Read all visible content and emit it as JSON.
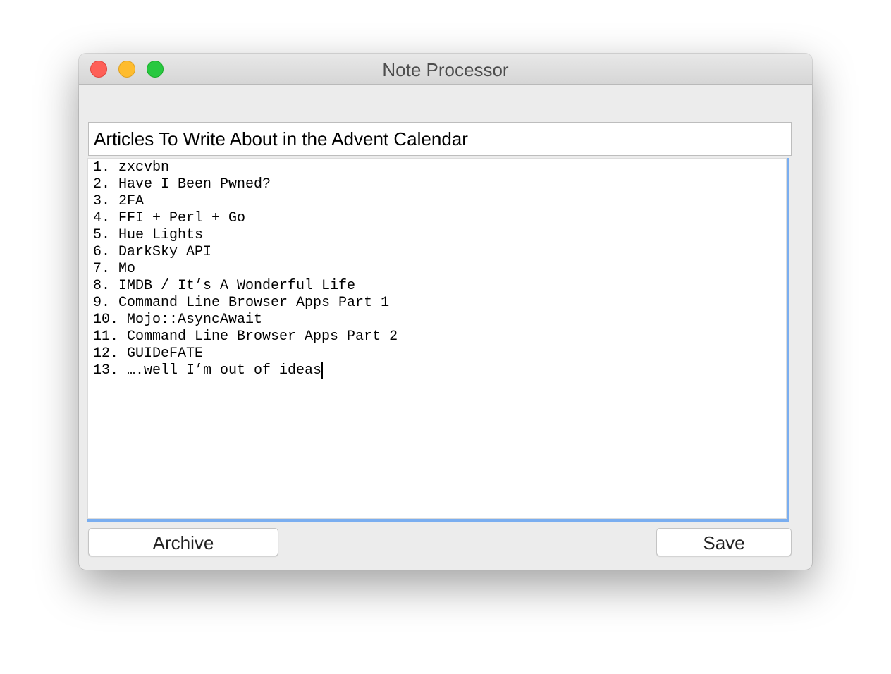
{
  "window": {
    "title": "Note Processor",
    "controls": {
      "close": "close-button",
      "minimize": "minimize-button",
      "maximize": "maximize-button"
    }
  },
  "note": {
    "title_value": "Articles To Write About in the Advent Calendar",
    "lines": [
      "1. zxcvbn",
      "2. Have I Been Pwned?",
      "3. 2FA",
      "4. FFI + Perl + Go",
      "5. Hue Lights",
      "6. DarkSky API",
      "7. Mo",
      "8. IMDB / It’s A Wonderful Life",
      "9. Command Line Browser Apps Part 1",
      "10. Mojo::AsyncAwait",
      "11. Command Line Browser Apps Part 2",
      "12. GUIDeFATE",
      "13. ….well I’m out of ideas"
    ]
  },
  "buttons": {
    "archive_label": "Archive",
    "save_label": "Save"
  },
  "colors": {
    "close": "#fe5f57",
    "minimize": "#febc2e",
    "maximize": "#28c840",
    "focus_ring": "#7aaef0"
  }
}
